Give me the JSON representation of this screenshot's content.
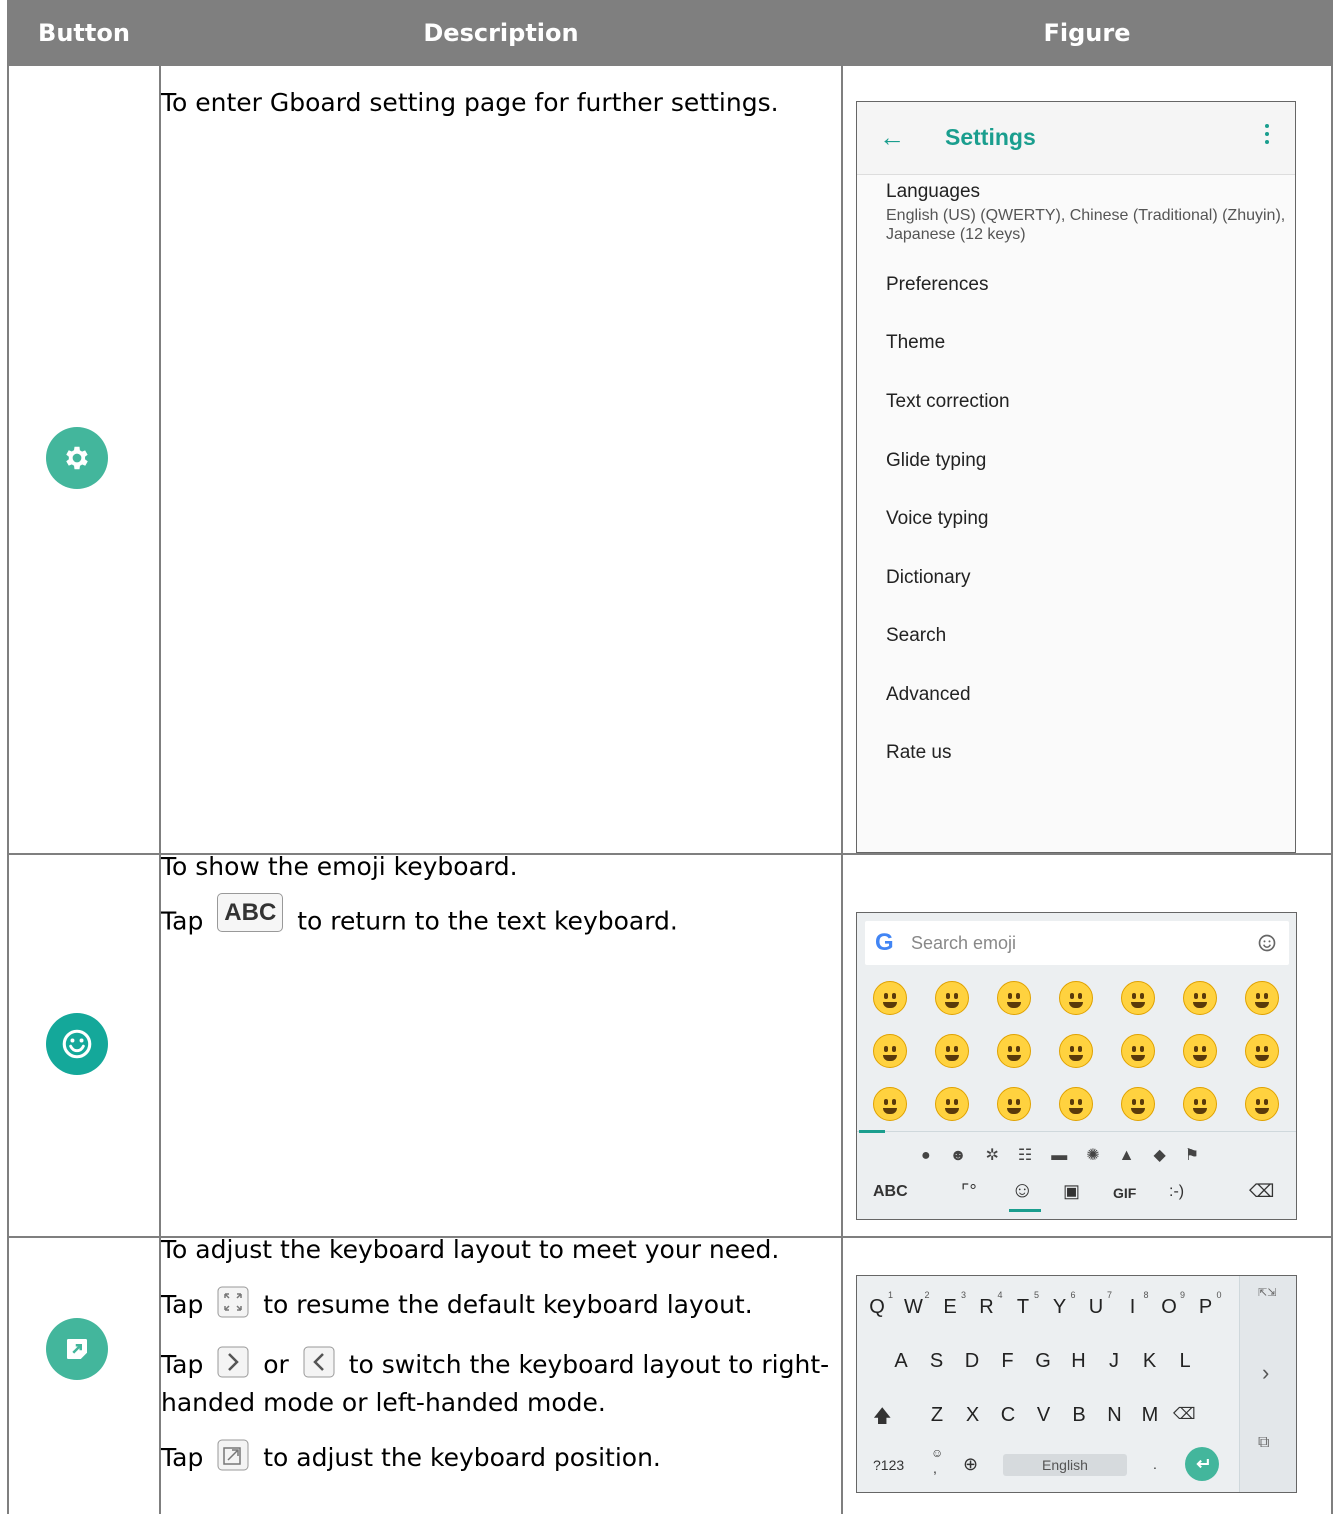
{
  "table": {
    "headers": [
      "Button",
      "Description",
      "Figure"
    ]
  },
  "rows": [
    {
      "desc": [
        "To enter Gboard setting page for further settings."
      ]
    },
    {
      "desc_line1": "To show the emoji keyboard.",
      "tap": "Tap",
      "abc_key": "ABC",
      "desc_line2_rest": "to return to the text keyboard."
    },
    {
      "line1": "To adjust the keyboard layout to meet your need.",
      "tap": "Tap",
      "line2_rest": "to resume the default keyboard layout.",
      "or": "or",
      "line3_rest": "to switch the keyboard layout to right-handed mode or left-handed mode.",
      "line4_rest": "to adjust the keyboard position."
    }
  ],
  "settings_fig": {
    "back_arrow": "←",
    "title": "Settings",
    "items": [
      "Languages",
      "Preferences",
      "Theme",
      "Text correction",
      "Glide typing",
      "Voice typing",
      "Dictionary",
      "Search",
      "Advanced",
      "Rate us"
    ],
    "languages_sub": "English (US) (QWERTY), Chinese (Traditional) (Zhuyin), Japanese (12 keys)"
  },
  "emoji_fig": {
    "google_g": "G",
    "search_placeholder": "Search emoji",
    "abc": "ABC",
    "gif": "GIF",
    "emoticon": ":-)"
  },
  "keyboard_fig": {
    "row1": [
      "Q",
      "W",
      "E",
      "R",
      "T",
      "Y",
      "U",
      "I",
      "O",
      "P"
    ],
    "row1_nums": [
      "1",
      "2",
      "3",
      "4",
      "5",
      "6",
      "7",
      "8",
      "9",
      "0"
    ],
    "row2": [
      "A",
      "S",
      "D",
      "F",
      "G",
      "H",
      "J",
      "K",
      "L"
    ],
    "row3": [
      "Z",
      "X",
      "C",
      "V",
      "B",
      "N",
      "M"
    ],
    "sym_key": "?123",
    "comma": ",",
    "period": ".",
    "space_label": "English"
  },
  "colors": {
    "header_bg": "#7f7f7f",
    "accent": "#43b69c",
    "teal": "#14a89a"
  }
}
